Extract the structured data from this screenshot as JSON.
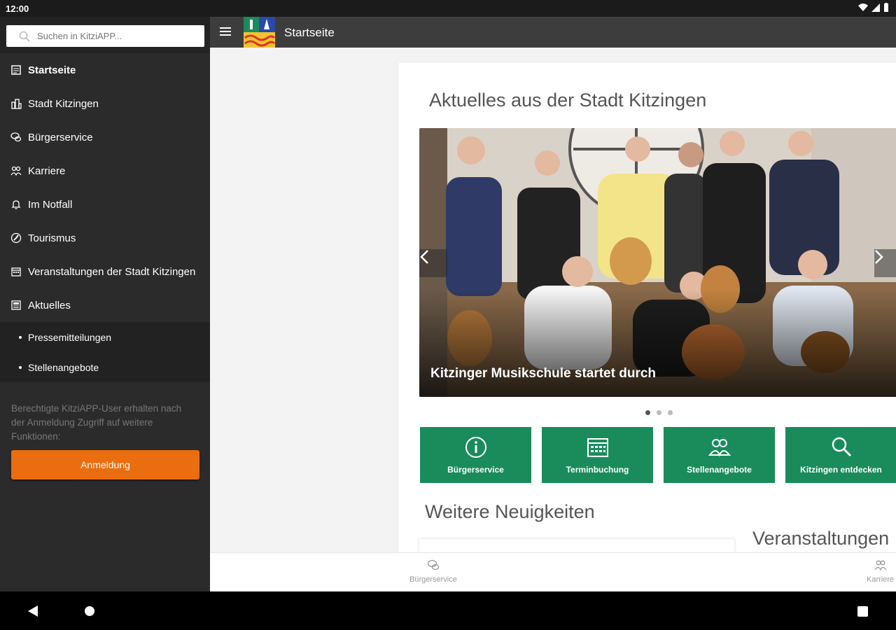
{
  "status_bar": {
    "time": "12:00"
  },
  "drawer": {
    "search_placeholder": "Suchen in KitziAPP...",
    "items": [
      {
        "label": "Startseite",
        "icon": "home-icon"
      },
      {
        "label": "Stadt Kitzingen",
        "icon": "city-icon"
      },
      {
        "label": "Bürgerservice",
        "icon": "chat-icon"
      },
      {
        "label": "Karriere",
        "icon": "people-icon"
      },
      {
        "label": "Im Notfall",
        "icon": "bell-icon"
      },
      {
        "label": "Tourismus",
        "icon": "compass-icon"
      },
      {
        "label": "Veranstaltungen der Stadt Kitzingen",
        "icon": "calendar-icon"
      },
      {
        "label": "Aktuelles",
        "icon": "news-icon"
      }
    ],
    "subitems": [
      {
        "label": "Pressemitteilungen"
      },
      {
        "label": "Stellenangebote"
      }
    ],
    "note": "Berechtigte KitziAPP-User erhalten nach der Anmeldung Zugriff auf weitere Funktionen:",
    "login_label": "Anmeldung"
  },
  "appbar": {
    "title": "Startseite"
  },
  "main": {
    "news_heading": "Aktuelles aus der Stadt Kitzingen",
    "slide_caption": "Kitzinger Musikschule startet durch",
    "slide_count": 3,
    "active_slide": 1,
    "tiles": [
      {
        "label": "Bürgerservice",
        "icon": "info-icon"
      },
      {
        "label": "Terminbuchung",
        "icon": "calendar-icon"
      },
      {
        "label": "Stellenangebote",
        "icon": "people-icon"
      },
      {
        "label": "Kitzingen entdecken",
        "icon": "search-icon"
      }
    ],
    "more_heading": "Weitere Neuigkeiten",
    "events_heading": "Veranstaltungen"
  },
  "bottom_nav": [
    {
      "label": "Bürgerservice",
      "icon": "chat-icon"
    },
    {
      "label": "Karriere",
      "icon": "people-icon"
    }
  ],
  "colors": {
    "accent_green": "#1a8c5c",
    "login_orange": "#ea6d0f",
    "drawer_bg": "#2b2b2b",
    "appbar_bg": "#3d3d3d"
  }
}
